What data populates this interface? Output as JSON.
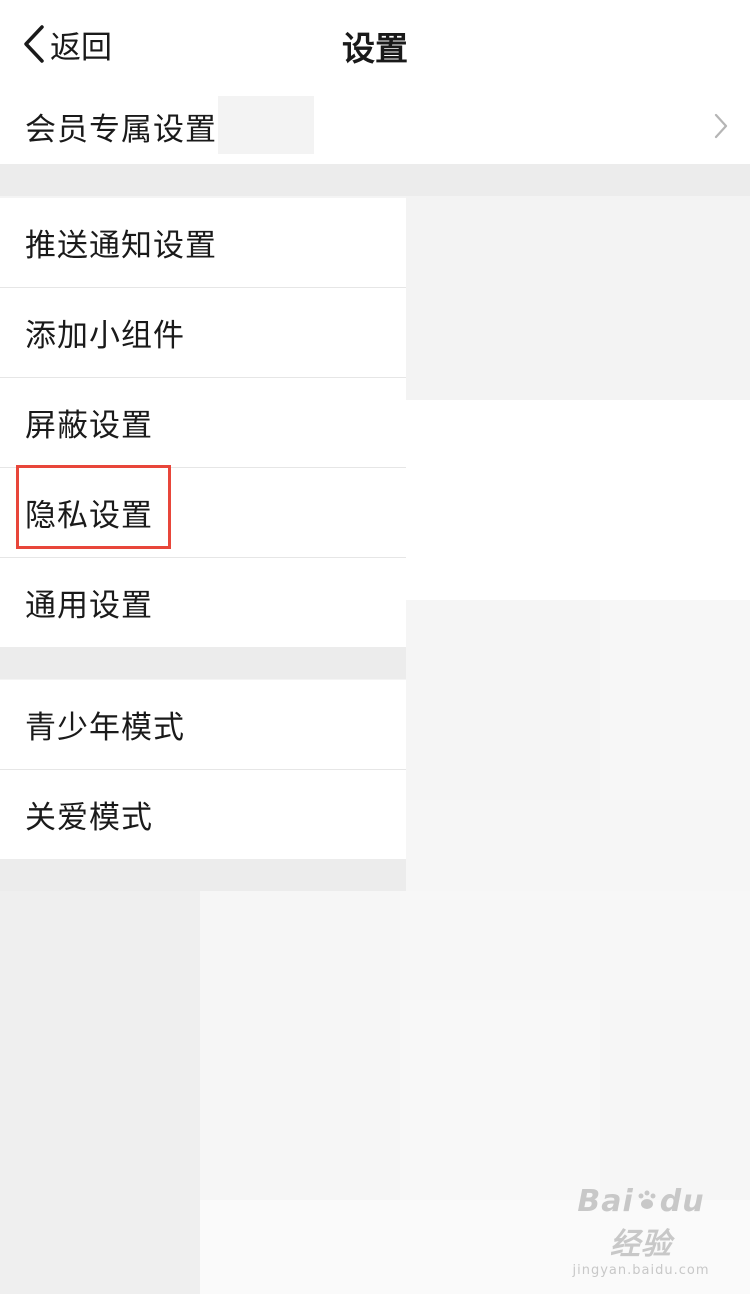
{
  "nav": {
    "back_label": "返回",
    "title": "设置"
  },
  "groups": [
    {
      "items": [
        {
          "label": "会员专属设置",
          "has_chevron": true
        }
      ]
    },
    {
      "items": [
        {
          "label": "推送通知设置"
        },
        {
          "label": "添加小组件"
        },
        {
          "label": "屏蔽设置"
        },
        {
          "label": "隐私设置",
          "highlighted": true
        },
        {
          "label": "通用设置"
        }
      ]
    },
    {
      "items": [
        {
          "label": "青少年模式"
        },
        {
          "label": "关爱模式"
        }
      ]
    }
  ],
  "watermark": {
    "logo_text_left": "Bai",
    "logo_text_mid": "du",
    "logo_text_right": "经验",
    "url": "jingyan.baidu.com"
  },
  "colors": {
    "highlight_border": "#e8463a",
    "row_background": "#ffffff",
    "section_gap": "#ececec",
    "text": "#1a1a1a",
    "divider": "#e6e6e6"
  },
  "icons": {
    "back": "chevron-left-icon",
    "row_arrow": "chevron-right-icon",
    "watermark_paw": "paw-icon"
  }
}
